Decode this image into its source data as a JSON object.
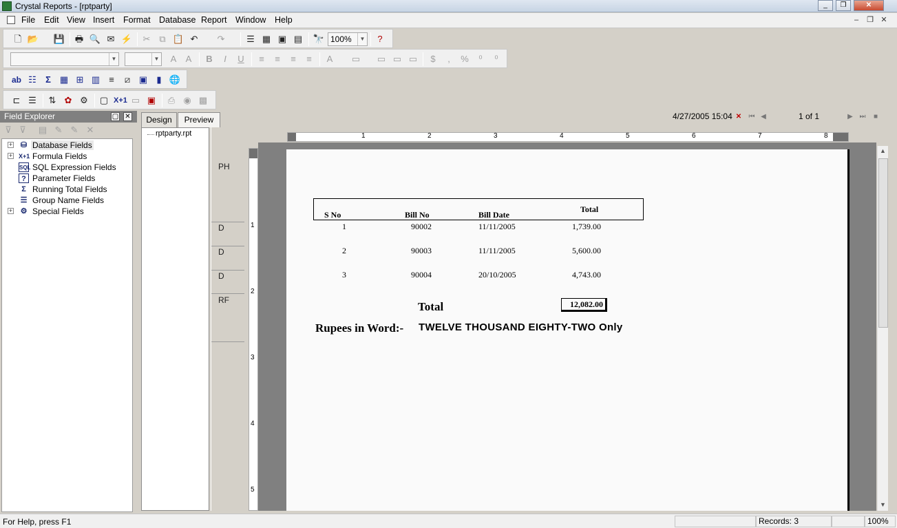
{
  "window": {
    "title": "Crystal Reports - [rptparty]"
  },
  "menu": [
    "File",
    "Edit",
    "View",
    "Insert",
    "Format",
    "Database",
    "Report",
    "Window",
    "Help"
  ],
  "toolbar": {
    "zoom": "100%"
  },
  "field_explorer": {
    "title": "Field Explorer",
    "items": [
      {
        "label": "Database Fields",
        "icon": "database-icon",
        "expandable": true
      },
      {
        "label": "Formula Fields",
        "icon": "formula-icon",
        "expandable": true
      },
      {
        "label": "SQL Expression Fields",
        "icon": "sql-icon",
        "expandable": false
      },
      {
        "label": "Parameter Fields",
        "icon": "parameter-icon",
        "expandable": false
      },
      {
        "label": "Running Total Fields",
        "icon": "sigma-icon",
        "expandable": false
      },
      {
        "label": "Group Name Fields",
        "icon": "group-icon",
        "expandable": false
      },
      {
        "label": "Special Fields",
        "icon": "special-icon",
        "expandable": true
      }
    ]
  },
  "tabs": {
    "design": "Design",
    "preview": "Preview"
  },
  "nav": {
    "datetime": "4/27/2005  15:04",
    "page": "1 of 1"
  },
  "doc_tree": {
    "root": "rptparty.rpt"
  },
  "sections": [
    "PH",
    "D",
    "D",
    "D",
    "RF"
  ],
  "ruler": {
    "h": [
      "1",
      "2",
      "3",
      "4",
      "5",
      "6",
      "7",
      "8"
    ],
    "v": [
      "1",
      "2",
      "3",
      "4",
      "5"
    ]
  },
  "report": {
    "headers": {
      "sno": "S No",
      "billno": "Bill No",
      "billdate": "Bill Date",
      "total": "Total"
    },
    "rows": [
      {
        "sno": "1",
        "billno": "90002",
        "billdate": "11/11/2005",
        "total": "1,739.00"
      },
      {
        "sno": "2",
        "billno": "90003",
        "billdate": "11/11/2005",
        "total": "5,600.00"
      },
      {
        "sno": "3",
        "billno": "90004",
        "billdate": "20/10/2005",
        "total": "4,743.00"
      }
    ],
    "total_label": "Total",
    "total_value": "12,082.00",
    "words_label": "Rupees in Word:-",
    "words_value": "TWELVE THOUSAND EIGHTY-TWO Only"
  },
  "status": {
    "help": "For Help, press F1",
    "records": "Records: 3",
    "zoom": "100%"
  }
}
